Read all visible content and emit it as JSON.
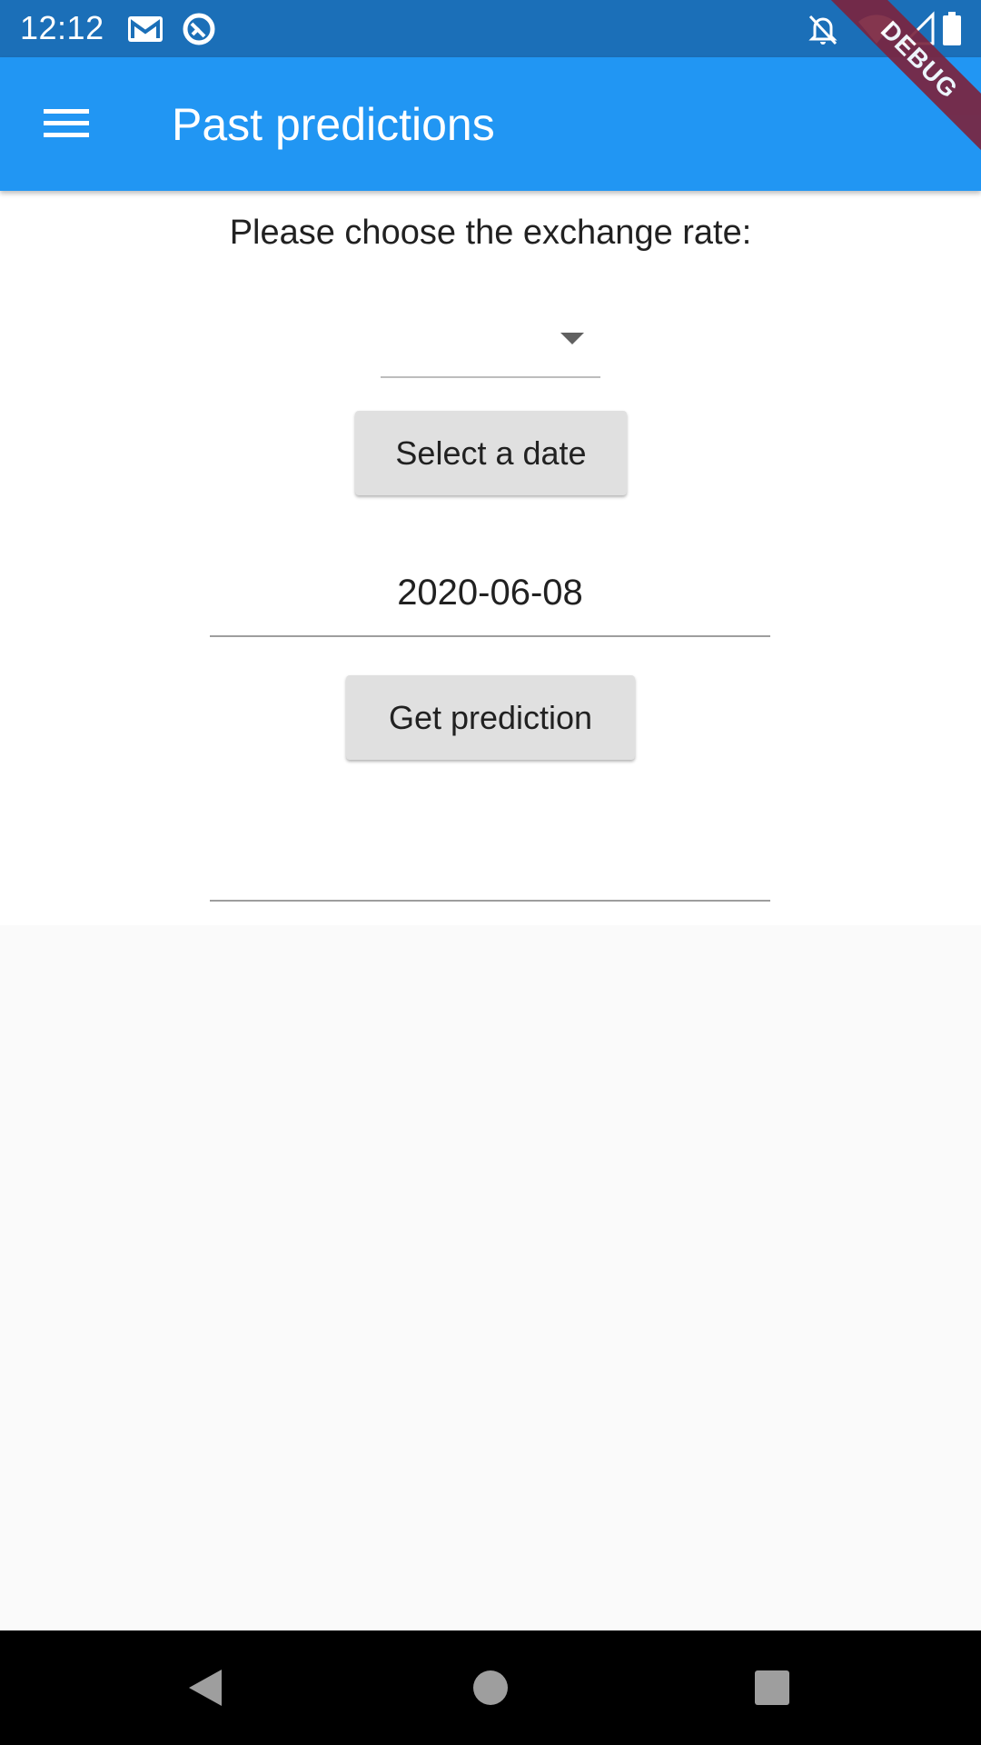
{
  "status_bar": {
    "time": "12:12",
    "icons": [
      "gmail-icon",
      "sync-icon",
      "notifications-off-icon",
      "wifi-icon",
      "signal-icon",
      "battery-icon"
    ]
  },
  "debug_banner": "DEBUG",
  "app_bar": {
    "title": "Past predictions",
    "menu_icon": "hamburger-menu-icon"
  },
  "form": {
    "prompt": "Please choose the exchange rate:",
    "exchange_rate_selected": "",
    "select_date_label": "Select a date",
    "date_value": "2020-06-08",
    "get_prediction_label": "Get prediction",
    "prediction_value": ""
  },
  "nav_bar": {
    "icons": [
      "back-icon",
      "home-icon",
      "recents-icon"
    ]
  },
  "colors": {
    "status_bar": "#1b6fb8",
    "app_bar": "#2196f3",
    "button": "#e0e0e0",
    "debug_ribbon": "#7a2540"
  }
}
